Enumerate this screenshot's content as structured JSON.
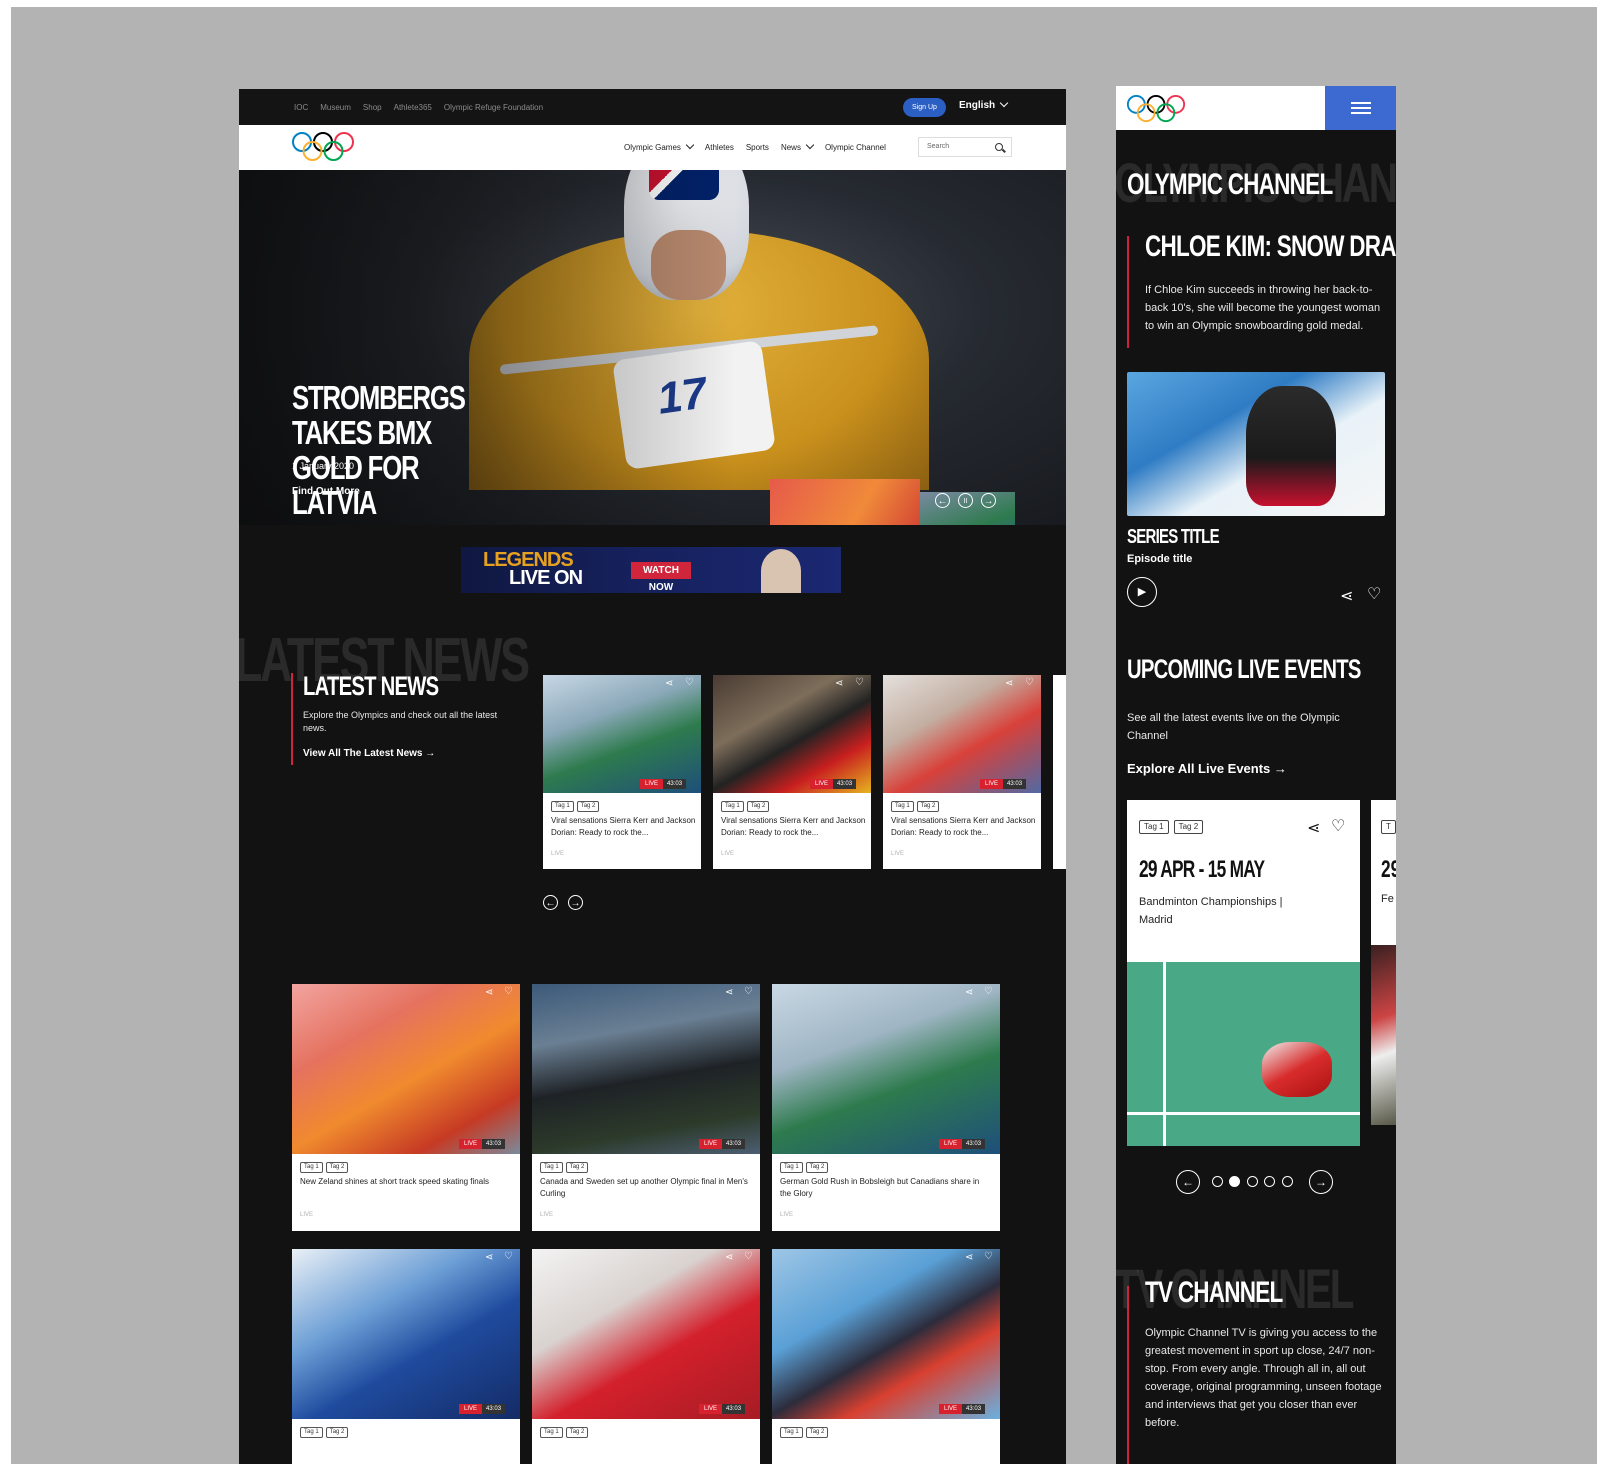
{
  "desktop": {
    "util_links": [
      "IOC",
      "Museum",
      "Shop",
      "Athlete365",
      "Olympic Refuge Foundation"
    ],
    "signup_label": "Sign Up",
    "language": "English",
    "nav": [
      "Olympic Games",
      "Athletes",
      "Sports",
      "News",
      "Olympic Channel"
    ],
    "search_placeholder": "Search",
    "hero": {
      "title": "STROMBERGS TAKES BMX GOLD FOR LATVIA",
      "date": "1 January 2020",
      "link": "Find Out More",
      "bib": "17"
    },
    "banner": {
      "line1": "LEGENDS",
      "line2": "LIVE ON",
      "cta": "WATCH NOW"
    },
    "latest_news": {
      "ghost": "LATEST NEWS",
      "title": "LATEST NEWS",
      "desc": "Explore the Olympics and check out all the latest news.",
      "link": "View All The Latest News"
    },
    "carousel_cards": [
      {
        "tags": [
          "Tag 1",
          "Tag 2"
        ],
        "text": "Viral sensations Sierra Kerr and Jackson Dorian: Ready to rock the...",
        "status": "LIVE",
        "live": "LIVE",
        "duration": "43:03"
      },
      {
        "tags": [
          "Tag 1",
          "Tag 2"
        ],
        "text": "Viral sensations Sierra Kerr and Jackson Dorian: Ready to rock the...",
        "status": "LIVE",
        "live": "LIVE",
        "duration": "43:03"
      },
      {
        "tags": [
          "Tag 1",
          "Tag 2"
        ],
        "text": "Viral sensations Sierra Kerr and Jackson Dorian: Ready to rock the...",
        "status": "LIVE",
        "live": "LIVE",
        "duration": "43:03"
      }
    ],
    "grid_cards": [
      {
        "tags": [
          "Tag 1",
          "Tag 2"
        ],
        "text": "New Zeland shines at short track speed skating finals",
        "status": "LIVE",
        "live": "LIVE",
        "duration": "43:03"
      },
      {
        "tags": [
          "Tag 1",
          "Tag 2"
        ],
        "text": "Canada and Sweden set up another Olympic final in Men's Curling",
        "status": "LIVE",
        "live": "LIVE",
        "duration": "43:03"
      },
      {
        "tags": [
          "Tag 1",
          "Tag 2"
        ],
        "text": "German Gold Rush in Bobsleigh but Canadians share in the Glory",
        "status": "LIVE",
        "live": "LIVE",
        "duration": "43:03"
      },
      {
        "tags": [
          "Tag 1",
          "Tag 2"
        ],
        "text": "",
        "status": "",
        "live": "LIVE",
        "duration": "43:03"
      },
      {
        "tags": [
          "Tag 1",
          "Tag 2"
        ],
        "text": "",
        "status": "",
        "live": "LIVE",
        "duration": "43:03"
      },
      {
        "tags": [
          "Tag 1",
          "Tag 2"
        ],
        "text": "",
        "status": "",
        "live": "LIVE",
        "duration": "43:03"
      }
    ]
  },
  "mobile": {
    "channel_ghost": "OLYMPIC CHANNEL",
    "channel_title": "OLYMPIC CHANNEL",
    "feature_title": "CHLOE KIM: SNOW DRAGON",
    "feature_desc": "If Chloe Kim succeeds in throwing her back-to-back 10's, she will become the youngest woman to win an Olympic snowboarding gold medal.",
    "series_title": "SERIES TITLE",
    "episode_title": "Episode title",
    "upcoming_title": "UPCOMING LIVE EVENTS",
    "upcoming_desc": "See all the latest events live on the Olympic Channel",
    "upcoming_link": "Explore All Live Events",
    "event": {
      "tags": [
        "Tag 1",
        "Tag 2"
      ],
      "date": "29 APR - 15 MAY",
      "name": "Bandminton Championships | Madrid"
    },
    "next_card_peek": {
      "tag": "T",
      "date": "29",
      "name": "Fe"
    },
    "pager_total": 5,
    "pager_active": 2,
    "tv_ghost": "TV CHANNEL",
    "tv_title": "TV CHANNEL",
    "tv_desc": "Olympic Channel TV is giving you access to the greatest movement in sport up close, 24/7 non-stop. From every angle. Through all in, all out coverage, original programming, unseen footage and interviews that get you closer than ever before."
  },
  "colors": {
    "accent_red": "#d0223c",
    "brand_blue": "#3c6ad1",
    "gold": "#e5a11f"
  }
}
